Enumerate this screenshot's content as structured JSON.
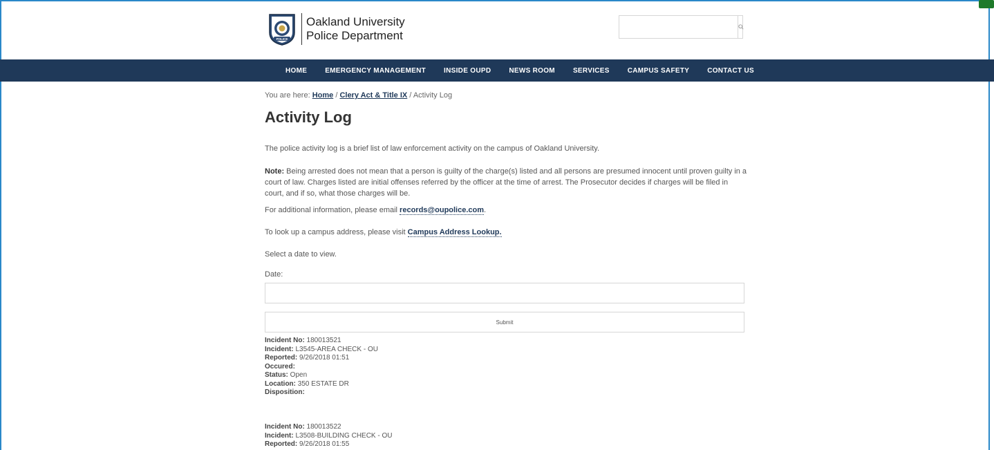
{
  "header": {
    "logo_line1": "Oakland University",
    "logo_line2": "Police Department",
    "badge_text": "POLICE",
    "search_placeholder": ""
  },
  "nav": {
    "items": [
      "HOME",
      "EMERGENCY MANAGEMENT",
      "INSIDE OUPD",
      "NEWS ROOM",
      "SERVICES",
      "CAMPUS SAFETY",
      "CONTACT US"
    ]
  },
  "breadcrumb": {
    "prefix": "You are here: ",
    "home": "Home",
    "sep": " / ",
    "parent": "Clery Act & Title IX",
    "current": "Activity Log"
  },
  "page": {
    "title": "Activity Log",
    "intro": "The police activity log is a brief list of law enforcement activity on the campus of Oakland University.",
    "note_label": "Note:",
    "note_text": " Being arrested does not mean that a person is guilty of the charge(s) listed and all persons are presumed innocent until proven guilty in a court of law. Charges listed are initial offenses referred by the officer at the time of arrest. The Prosecutor decides if charges will be filed in court, and if so, what those charges will be.",
    "email_prefix": "For additional information, please email ",
    "email_link": "records@oupolice.com",
    "email_suffix": ".",
    "lookup_prefix": "To look up a campus address, please visit ",
    "lookup_link": "Campus Address Lookup.",
    "select_text": "Select a date to view.",
    "date_label": "Date:",
    "submit_label": "Submit"
  },
  "incidents": [
    {
      "no_label": "Incident No:",
      "no": " 180013521",
      "inc_label": "Incident:",
      "inc": " L3545-AREA CHECK - OU",
      "rep_label": "Reported:",
      "rep": " 9/26/2018 01:51",
      "occ_label": "Occured:",
      "occ": "",
      "status_label": "Status:",
      "status": " Open",
      "loc_label": "Location:",
      "loc": " 350 ESTATE DR",
      "disp_label": "Disposition:",
      "disp": ""
    },
    {
      "no_label": "Incident No:",
      "no": " 180013522",
      "inc_label": "Incident:",
      "inc": " L3508-BUILDING CHECK - OU",
      "rep_label": "Reported:",
      "rep": " 9/26/2018 01:55"
    }
  ]
}
